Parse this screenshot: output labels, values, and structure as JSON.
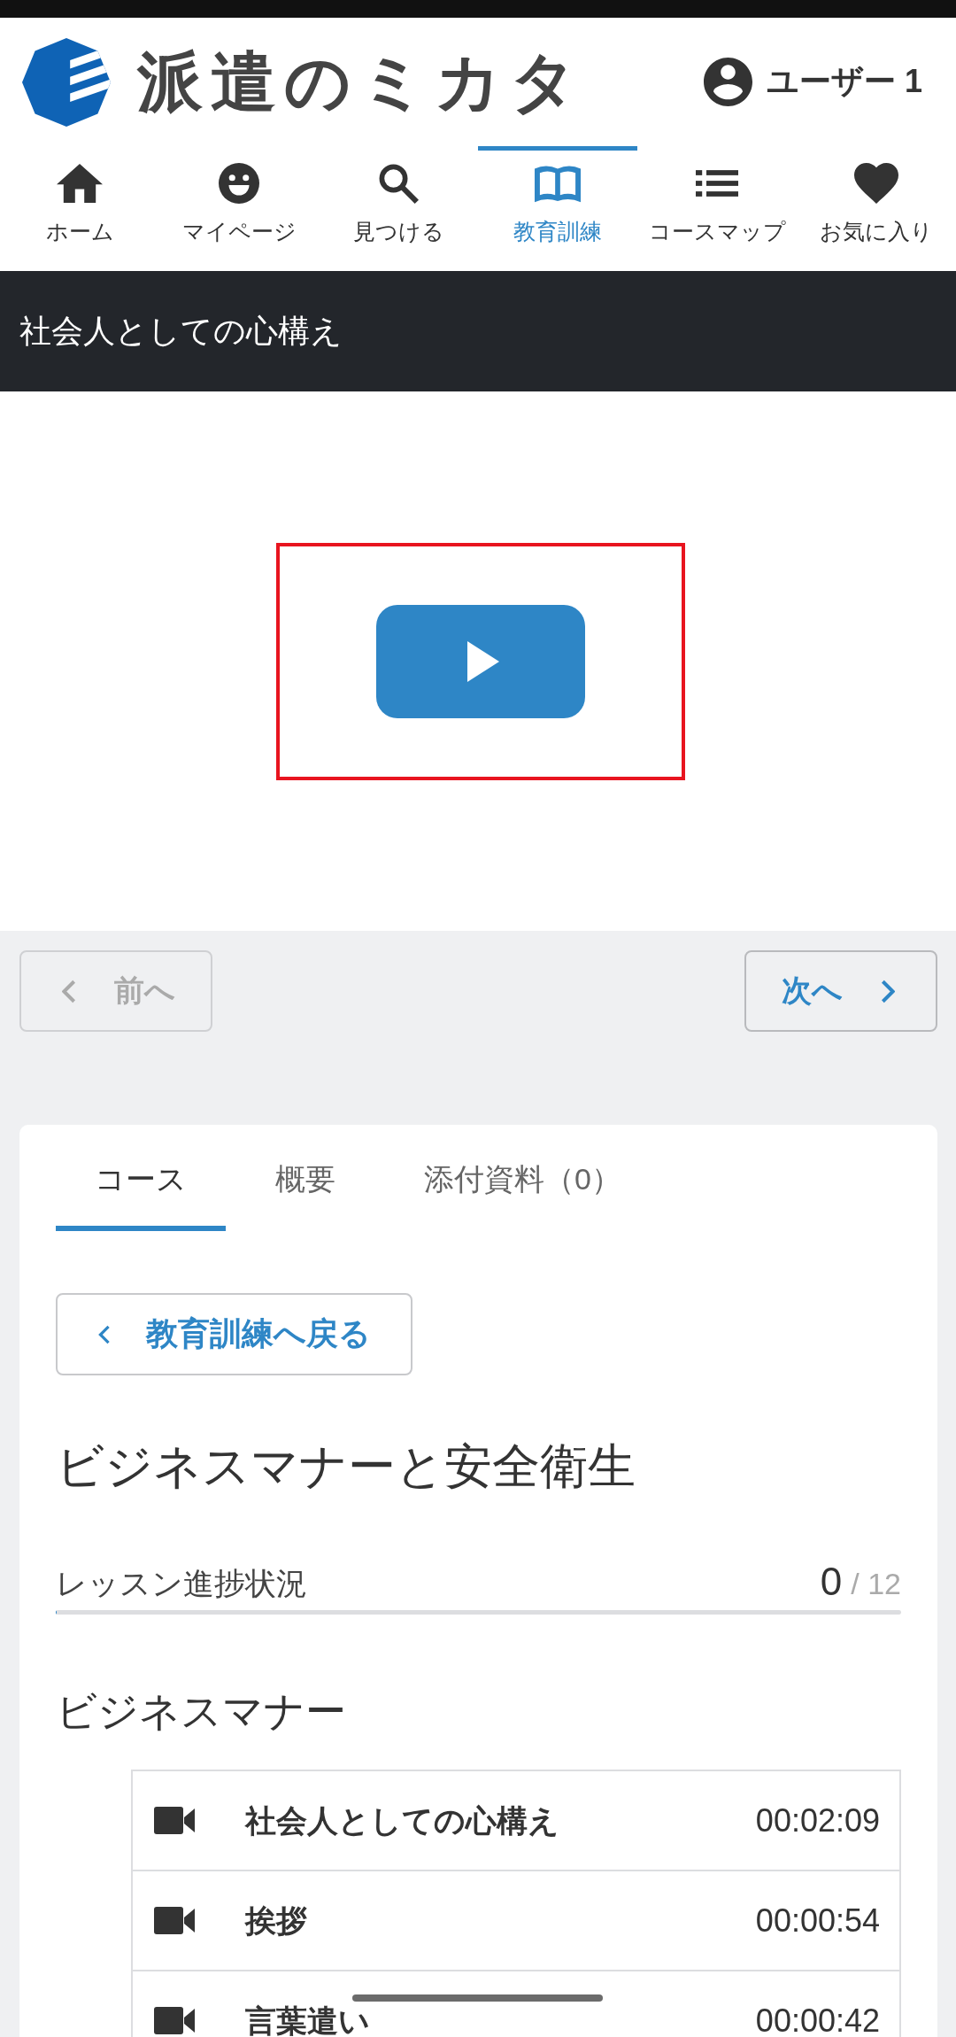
{
  "header": {
    "logo_text": "派遣のミカタ",
    "user_name": "ユーザー 1"
  },
  "nav": {
    "items": [
      {
        "label": "ホーム",
        "selected": false
      },
      {
        "label": "マイページ",
        "selected": false
      },
      {
        "label": "見つける",
        "selected": false
      },
      {
        "label": "教育訓練",
        "selected": true
      },
      {
        "label": "コースマップ",
        "selected": false
      },
      {
        "label": "お気に入り",
        "selected": false
      }
    ]
  },
  "lesson_title": "社会人としての心構え",
  "pager": {
    "previous": {
      "label": "前へ",
      "disabled": true
    },
    "next": {
      "label": "次へ",
      "disabled": false
    }
  },
  "course": {
    "tabs": [
      {
        "label": "コース",
        "selected": true
      },
      {
        "label": "概要",
        "selected": false
      },
      {
        "label": "添付資料（0）",
        "selected": false
      }
    ],
    "back_button": "教育訓練へ戻る",
    "title": "ビジネスマナーと安全衛生",
    "progress": {
      "label": "レッスン進捗状況",
      "completed": "0",
      "total": "/ 12",
      "level": 0
    },
    "sections": [
      {
        "heading": "ビジネスマナー",
        "lessons": [
          {
            "title": "社会人としての心構え",
            "duration": "00:02:09"
          },
          {
            "title": "挨拶",
            "duration": "00:00:54"
          },
          {
            "title": "言葉遣い",
            "duration": "00:00:42"
          }
        ]
      }
    ]
  }
}
